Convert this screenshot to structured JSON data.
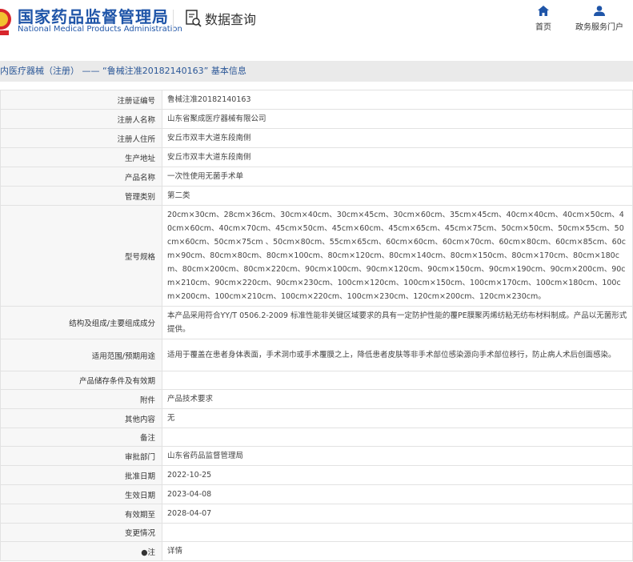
{
  "header": {
    "logo_cn": "国家药品监督管理局",
    "logo_en": "National Medical Products Administration",
    "data_query": "数据查询",
    "nav": [
      {
        "label": "首页",
        "icon": "home-icon"
      },
      {
        "label": "政务服务门户",
        "icon": "user-icon"
      }
    ],
    "brand_color": "#1f55a8"
  },
  "title": "内医疗器械（注册） —— “鲁械注准20182140163” 基本信息",
  "rows": [
    {
      "label": "注册证编号",
      "value": "鲁械注准20182140163"
    },
    {
      "label": "注册人名称",
      "value": "山东省聚成医疗器械有限公司"
    },
    {
      "label": "注册人住所",
      "value": "安丘市双丰大道东段南侧"
    },
    {
      "label": "生产地址",
      "value": "安丘市双丰大道东段南侧"
    },
    {
      "label": "产品名称",
      "value": "一次性使用无菌手术单"
    },
    {
      "label": "管理类别",
      "value": "第二类"
    },
    {
      "label": "型号规格",
      "value": "20cm×30cm、28cm×36cm、30cm×40cm、30cm×45cm、30cm×60cm、35cm×45cm、40cm×40cm、40cm×50cm、40cm×60cm、40cm×70cm、45cm×50cm、45cm×60cm、45cm×65cm、45cm×75cm、50cm×50cm、50cm×55cm、50cm×60cm、50cm×75cm 、50cm×80cm、55cm×65cm、60cm×60cm、60cm×70cm、60cm×80cm、60cm×85cm、60cm×90cm、80cm×80cm、80cm×100cm、80cm×120cm、80cm×140cm、80cm×150cm、80cm×170cm、80cm×180cm、80cm×200cm、80cm×220cm、90cm×100cm、90cm×120cm、90cm×150cm、90cm×190cm、90cm×200cm、90cm×210cm、90cm×220cm、90cm×230cm、100cm×120cm、100cm×150cm、100cm×170cm、100cm×180cm、100cm×200cm、100cm×210cm、100cm×220cm、100cm×230cm、120cm×200cm、120cm×230cm。"
    },
    {
      "label": "结构及组成/主要组成成分",
      "value": "本产品采用符合YY/T 0506.2-2009 标准性能非关键区域要求的具有一定防护性能的覆PE膜聚丙烯纺粘无纺布材料制成。产品以无菌形式提供。"
    },
    {
      "label": "适用范围/预期用途",
      "value": "适用于覆盖在患者身体表面，手术洞巾或手术覆膜之上，降低患者皮肤等非手术部位感染源向手术部位移行，防止病人术后创面感染。"
    },
    {
      "label": "产品储存条件及有效期",
      "value": ""
    },
    {
      "label": "附件",
      "value": "产品技术要求"
    },
    {
      "label": "其他内容",
      "value": "无"
    },
    {
      "label": "备注",
      "value": ""
    },
    {
      "label": "审批部门",
      "value": "山东省药品监督管理局"
    },
    {
      "label": "批准日期",
      "value": "2022-10-25"
    },
    {
      "label": "生效日期",
      "value": "2023-04-08"
    },
    {
      "label": "有效期至",
      "value": "2028-04-07"
    },
    {
      "label": "变更情况",
      "value": ""
    },
    {
      "label": "●注",
      "value": "详情"
    }
  ]
}
